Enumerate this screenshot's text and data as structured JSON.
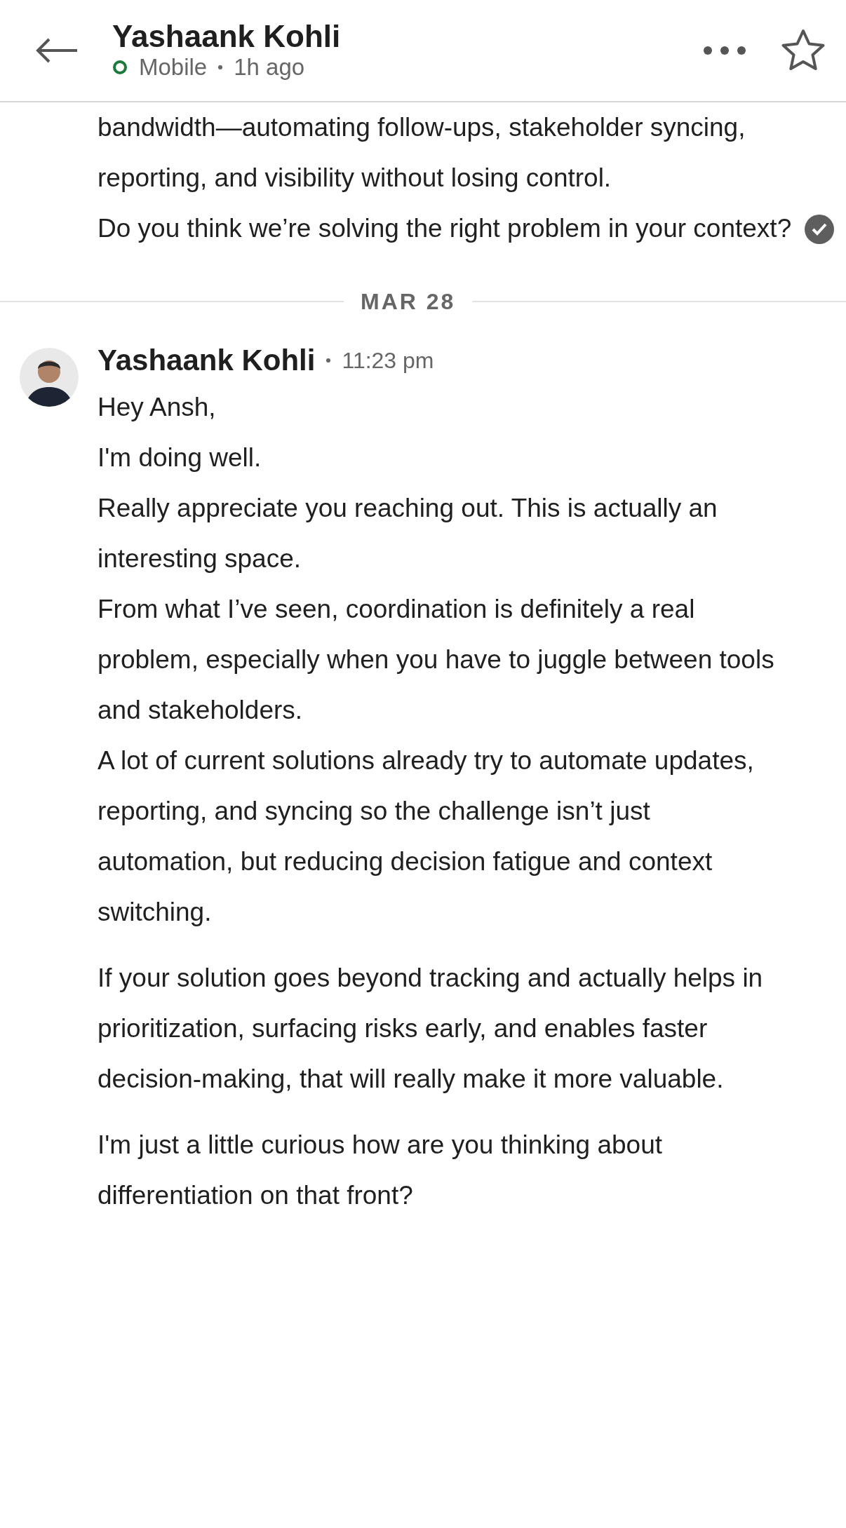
{
  "header": {
    "name": "Yashaank Kohli",
    "presence": "Mobile",
    "time": "1h ago"
  },
  "earlier_message": {
    "blocks": [
      {
        "lines": [
          "bandwidth—automating follow-ups, stakeholder syncing, reporting, and visibility without losing control.",
          "Do you think we’re solving the right problem in your context?"
        ]
      }
    ],
    "seen": true
  },
  "date_divider": "MAR 28",
  "message": {
    "sender": "Yashaank Kohli",
    "time": "11:23 pm",
    "blocks": [
      {
        "lines": [
          "Hey Ansh,",
          "I'm doing well.",
          "Really appreciate you reaching out. This is actually an interesting space.",
          "From what I’ve seen, coordination is definitely a real problem, especially when you have to juggle between tools and stakeholders.",
          "A lot of current solutions already try to automate updates, reporting, and syncing so the challenge isn’t just automation, but reducing decision fatigue and context switching."
        ]
      },
      {
        "lines": [
          "If your solution goes beyond tracking and actually helps in prioritization, surfacing risks early, and enables faster decision-making, that will really make it more valuable."
        ]
      },
      {
        "lines": [
          "I'm just a little curious how are you thinking about differentiation on that front?"
        ]
      }
    ]
  }
}
